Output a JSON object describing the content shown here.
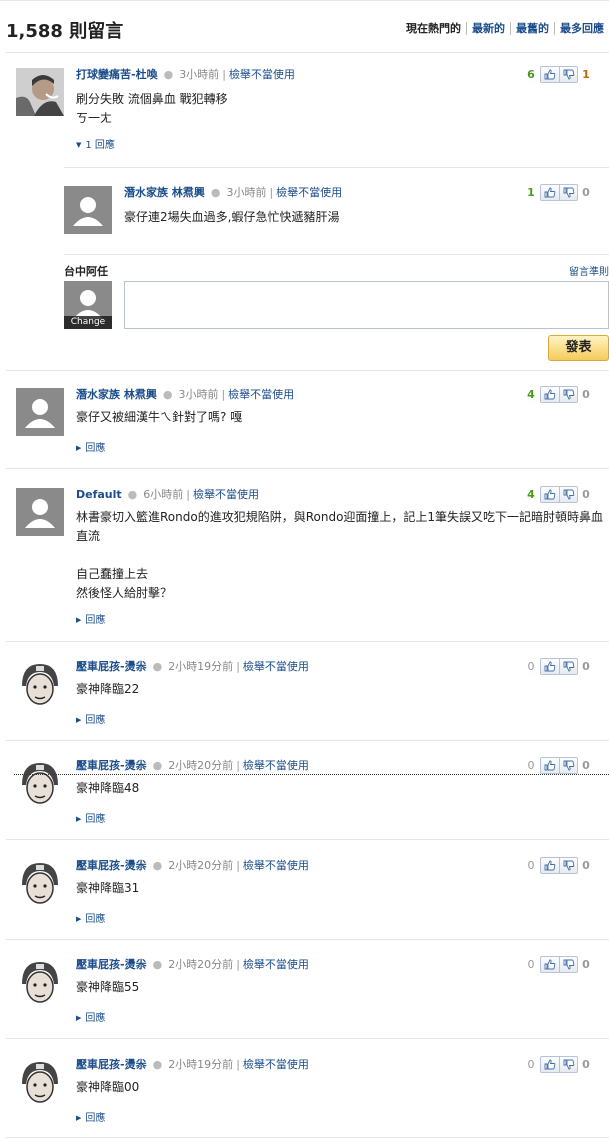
{
  "header": {
    "title": "1,588 則留言",
    "sort_tabs": [
      "現在熱門的",
      "最新的",
      "最舊的",
      "最多回應"
    ]
  },
  "comments": [
    {
      "author": "打球變痛苦-杜喚",
      "time": "3小時前",
      "report": "檢舉不當使用",
      "text": "刷分失敗 流個鼻血 戰犯轉移\nㄎ一ㄤ",
      "reply_label": "1 回應",
      "up": "6",
      "down": "1"
    },
    {
      "author": "潛水家族 林焄興",
      "time": "3小時前",
      "report": "檢舉不當使用",
      "text": "豪仔連2場失血過多,蝦仔急忙快遞豬肝湯",
      "up": "1",
      "down": "0"
    },
    {
      "author": "潛水家族 林焄興",
      "time": "3小時前",
      "report": "檢舉不當使用",
      "text": "豪仔又被細漢牛ㄟ針對了嗎? 嘎",
      "reply_label": "回應",
      "up": "4",
      "down": "0"
    },
    {
      "author": "Default",
      "time": "6小時前",
      "report": "檢舉不當使用",
      "text": "林書豪切入籃進Rondo的進攻犯規陷阱，與Rondo迎面撞上，記上1筆失誤又吃下一記暗肘頓時鼻血直流\n\n自己蠢撞上去\n然後怪人給肘擊？",
      "reply_label": "回應",
      "up": "4",
      "down": "0"
    },
    {
      "author": "壓車屁孩-燙尜",
      "time": "2小時19分前",
      "report": "檢舉不當使用",
      "text": "豪神降臨22",
      "reply_label": "回應",
      "up": "0",
      "down": "0"
    },
    {
      "author": "壓車屁孩-燙尜",
      "time": "2小時20分前",
      "report": "檢舉不當使用",
      "text": "豪神降臨48",
      "reply_label": "回應",
      "up": "0",
      "down": "0"
    },
    {
      "author": "壓車屁孩-燙尜",
      "time": "2小時20分前",
      "report": "檢舉不當使用",
      "text": "豪神降臨31",
      "reply_label": "回應",
      "up": "0",
      "down": "0"
    },
    {
      "author": "壓車屁孩-燙尜",
      "time": "2小時20分前",
      "report": "檢舉不當使用",
      "text": "豪神降臨55",
      "reply_label": "回應",
      "up": "0",
      "down": "0"
    },
    {
      "author": "壓車屁孩-燙尜",
      "time": "2小時19分前",
      "report": "檢舉不當使用",
      "text": "豪神降臨00",
      "reply_label": "回應",
      "up": "0",
      "down": "0"
    }
  ],
  "reply_box": {
    "user_name": "台中阿任",
    "guidelines_link": "留言準則",
    "change_label": "Change",
    "submit_label": "發表"
  },
  "colors": {
    "link_blue": "#1b4d8c",
    "vote_up_green": "#4a9a1e",
    "vote_down_orange": "#c06a00",
    "submit_yellow": "#f4cc5a"
  }
}
